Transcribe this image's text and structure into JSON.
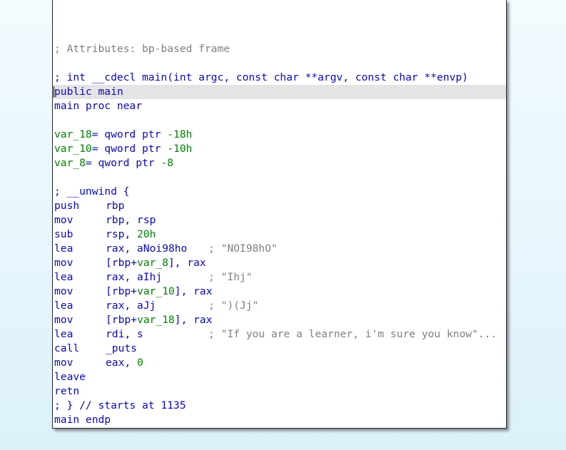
{
  "window": {
    "lines": [
      {
        "kind": "blank"
      },
      {
        "kind": "comment",
        "text": "; Attributes: bp-based frame"
      },
      {
        "kind": "blank"
      },
      {
        "kind": "proto",
        "text": "; int __cdecl main(int argc, const char **argv, const char **envp)"
      },
      {
        "kind": "label",
        "text": "public main",
        "highlight": true,
        "caret": true
      },
      {
        "kind": "label",
        "text": "main proc near"
      },
      {
        "kind": "blank"
      },
      {
        "kind": "var",
        "name": "var_18",
        "eq": "= qword ptr ",
        "value": "-18h"
      },
      {
        "kind": "var",
        "name": "var_10",
        "eq": "= qword ptr ",
        "value": "-10h"
      },
      {
        "kind": "var",
        "name": "var_8",
        "eq": "= qword ptr ",
        "value": "-8"
      },
      {
        "kind": "blank"
      },
      {
        "kind": "label",
        "text": "; __unwind {"
      },
      {
        "kind": "ins",
        "op": "push",
        "args": [
          {
            "t": "rbp",
            "c": "blue"
          }
        ]
      },
      {
        "kind": "ins",
        "op": "mov",
        "args": [
          {
            "t": "rbp, rsp",
            "c": "blue"
          }
        ]
      },
      {
        "kind": "ins",
        "op": "sub",
        "args": [
          {
            "t": "rsp, ",
            "c": "blue"
          },
          {
            "t": "20h",
            "c": "green"
          }
        ]
      },
      {
        "kind": "ins",
        "op": "lea",
        "args": [
          {
            "t": "rax, aNoi98ho",
            "c": "blue"
          }
        ],
        "comment": "; \"NOI98hO\""
      },
      {
        "kind": "ins",
        "op": "mov",
        "args": [
          {
            "t": "[rbp+",
            "c": "blue"
          },
          {
            "t": "var_8",
            "c": "green"
          },
          {
            "t": "], rax",
            "c": "blue"
          }
        ]
      },
      {
        "kind": "ins",
        "op": "lea",
        "args": [
          {
            "t": "rax, aIhj",
            "c": "blue"
          }
        ],
        "comment": "; \"Ihj\""
      },
      {
        "kind": "ins",
        "op": "mov",
        "args": [
          {
            "t": "[rbp+",
            "c": "blue"
          },
          {
            "t": "var_10",
            "c": "green"
          },
          {
            "t": "], rax",
            "c": "blue"
          }
        ]
      },
      {
        "kind": "ins",
        "op": "lea",
        "args": [
          {
            "t": "rax, aJj",
            "c": "blue"
          }
        ],
        "comment": "; \")(Jj\""
      },
      {
        "kind": "ins",
        "op": "mov",
        "args": [
          {
            "t": "[rbp+",
            "c": "blue"
          },
          {
            "t": "var_18",
            "c": "green"
          },
          {
            "t": "], rax",
            "c": "blue"
          }
        ]
      },
      {
        "kind": "ins",
        "op": "lea",
        "args": [
          {
            "t": "rdi, s",
            "c": "blue"
          }
        ],
        "comment": "; \"If you are a learner, i'm sure you know\"..."
      },
      {
        "kind": "ins",
        "op": "call",
        "args": [
          {
            "t": "_puts",
            "c": "blue"
          }
        ]
      },
      {
        "kind": "ins",
        "op": "mov",
        "args": [
          {
            "t": "eax, ",
            "c": "blue"
          },
          {
            "t": "0",
            "c": "green"
          }
        ]
      },
      {
        "kind": "ins",
        "op": "leave",
        "args": []
      },
      {
        "kind": "ins",
        "op": "retn",
        "args": []
      },
      {
        "kind": "label",
        "text": "; } // starts at 1135"
      },
      {
        "kind": "label",
        "text": "main endp"
      }
    ]
  },
  "colors": {
    "mnemonic": "#0a0ab4",
    "constant": "#008000",
    "comment": "#808080",
    "highlight": "#e4e4e4"
  }
}
